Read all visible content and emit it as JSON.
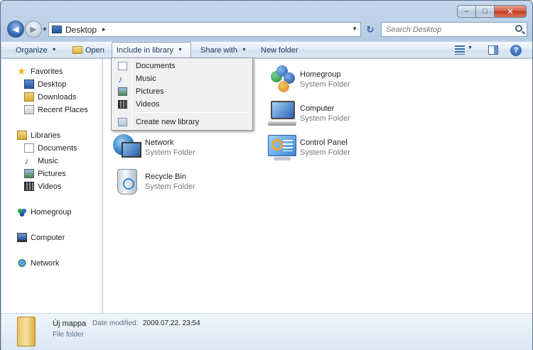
{
  "window": {
    "minimize_glyph": "–",
    "maximize_glyph": "□",
    "close_glyph": "✕"
  },
  "address": {
    "location": "Desktop",
    "separator": "▸",
    "search_placeholder": "Search Desktop"
  },
  "toolbar": {
    "organize": "Organize",
    "open": "Open",
    "include_in_library": "Include in library",
    "share_with": "Share with",
    "new_folder": "New folder",
    "help_glyph": "?"
  },
  "nav": {
    "favorites": "Favorites",
    "desktop": "Desktop",
    "downloads": "Downloads",
    "recent_places": "Recent Places",
    "libraries": "Libraries",
    "documents": "Documents",
    "music": "Music",
    "pictures": "Pictures",
    "videos": "Videos",
    "homegroup": "Homegroup",
    "computer": "Computer",
    "network": "Network"
  },
  "items": {
    "homegroup": {
      "name": "Homegroup",
      "type": "System Folder"
    },
    "computer": {
      "name": "Computer",
      "type": "System Folder"
    },
    "network": {
      "name": "Network",
      "type": "System Folder"
    },
    "control_panel": {
      "name": "Control Panel",
      "type": "System Folder"
    },
    "recycle_bin": {
      "name": "Recycle Bin",
      "type": "System Folder"
    }
  },
  "menu": {
    "documents": "Documents",
    "music": "Music",
    "pictures": "Pictures",
    "videos": "Videos",
    "create_new_library": "Create new library"
  },
  "details": {
    "name": "Új mappa",
    "modified_label": "Date modified:",
    "modified_value": "2009.07.22. 23:54",
    "type": "File folder"
  }
}
